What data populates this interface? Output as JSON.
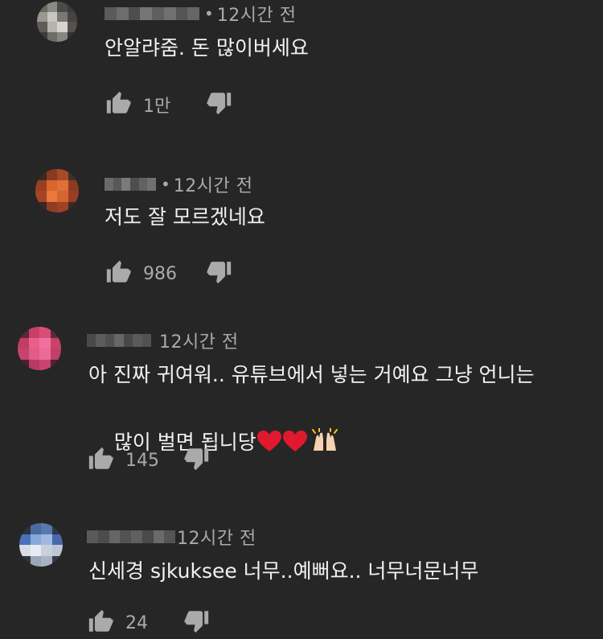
{
  "comments": [
    {
      "time": "12시간 전",
      "text": "안알랴줌. 돈 많이버세요",
      "likes": "1만",
      "avatar_colors": [
        "#6b6a66",
        "#8b8a86",
        "#4a4a48",
        "#3a3a3a",
        "#9a9890",
        "#c8c6c0",
        "#7a7874",
        "#444444",
        "#5e5d5a",
        "#b5b3ad",
        "#d6d4ce",
        "#55524e",
        "#3c3c3c",
        "#6e6c68",
        "#888682",
        "#333333"
      ],
      "name_colors": [
        "#5a5a5a",
        "#6d6d6d",
        "#4e4e4e",
        "#767676",
        "#5f5f5f",
        "#707070",
        "#545454",
        "#666666"
      ]
    },
    {
      "time": "12시간 전",
      "text": "저도 잘 모르겠네요",
      "likes": "986",
      "avatar_colors": [
        "#3a2a22",
        "#8a3a20",
        "#a84a28",
        "#40302a",
        "#9a3e22",
        "#d8642e",
        "#e07038",
        "#8c3a20",
        "#a44424",
        "#e8783c",
        "#d46430",
        "#9a3e24",
        "#3a2822",
        "#8e3c22",
        "#a04226",
        "#382a24"
      ],
      "name_colors": [
        "#6a6a6a",
        "#585858",
        "#7a7a7a",
        "#4e4e4e",
        "#626262",
        "#707070"
      ]
    },
    {
      "time": "12시간 전",
      "text_lines": [
        "아 진짜 귀여워.. 유튜브에서 넣는 거예요 그냥 언니는",
        "많이 벌면 됩니당"
      ],
      "likes": "145",
      "avatar_colors": [
        "#5a2838",
        "#c8406a",
        "#d84e78",
        "#5c2a3a",
        "#c23c66",
        "#e8608a",
        "#f070a0",
        "#c8426c",
        "#c84270",
        "#e25c88",
        "#ec6a96",
        "#c24068",
        "#4a2232",
        "#b83a62",
        "#c8446e",
        "#4c2434"
      ],
      "name_colors": [
        "#4a4a4a",
        "#5c5c5c",
        "#505050",
        "#666666",
        "#484848",
        "#5a5a5a",
        "#525252"
      ]
    },
    {
      "time": "12시간 전",
      "text": "신세경 sjkuksee 너무..예뻐요.. 너무너문너무",
      "likes": "24",
      "avatar_colors": [
        "#2a3242",
        "#4a6aa0",
        "#5878b0",
        "#303848",
        "#4a70b8",
        "#88a8d8",
        "#a0b8e0",
        "#4a68a8",
        "#d8dce4",
        "#e8ecf2",
        "#c8d0dc",
        "#bcc6d4",
        "#303440",
        "#9aa6b8",
        "#a8b2c2",
        "#363a44"
      ],
      "name_colors": [
        "#5a5a5a",
        "#4c4c4c",
        "#666666",
        "#525252",
        "#606060",
        "#4a4a4a",
        "#6a6a6a",
        "#545454"
      ]
    }
  ],
  "icons": {
    "like": "thumbs-up-icon",
    "dislike": "thumbs-down-icon",
    "heart": "red-heart-emoji",
    "hands": "raising-hands-emoji"
  }
}
